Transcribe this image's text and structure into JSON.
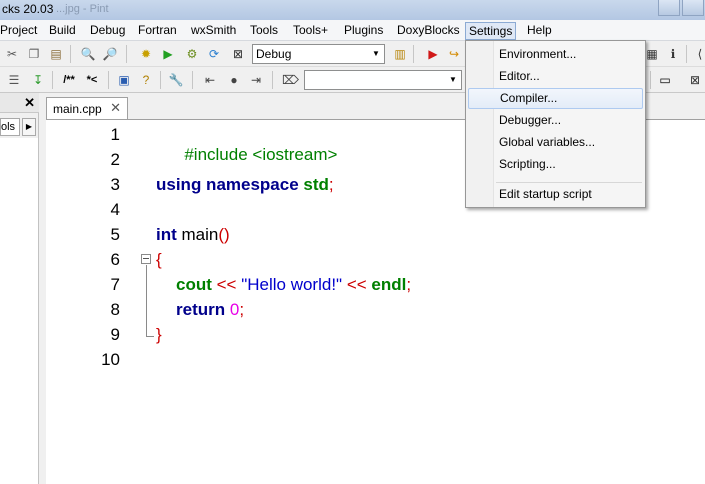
{
  "window": {
    "title": "cks 20.03",
    "title_ghost": "...jpg - Pint"
  },
  "menubar": {
    "items": [
      "Project",
      "Build",
      "Debug",
      "Fortran",
      "wxSmith",
      "Tools",
      "Tools+",
      "Plugins",
      "DoxyBlocks",
      "Settings",
      "Help"
    ],
    "active": "Settings"
  },
  "toolbar": {
    "build_target": "Debug"
  },
  "left_panel": {
    "tab_label": "ols"
  },
  "editor": {
    "tab_label": "main.cpp",
    "line_numbers": [
      "1",
      "2",
      "3",
      "4",
      "5",
      "6",
      "7",
      "8",
      "9",
      "10"
    ],
    "code": {
      "l1": "#include <iostream>",
      "l3_kw1": "using namespace",
      "l3_id": "std",
      "l3_end": ";",
      "l5_kw": "int",
      "l5_name": " main",
      "l5_paren": "()",
      "l6": "{",
      "l7_cout": "cout",
      "l7_op1": " << ",
      "l7_str": "\"Hello world!\"",
      "l7_op2": " << ",
      "l7_endl": "endl",
      "l7_end": ";",
      "l8_kw": "return",
      "l8_num": "0",
      "l8_end": ";",
      "l9": "}"
    }
  },
  "settings_menu": {
    "items": [
      "Environment...",
      "Editor...",
      "Compiler...",
      "Debugger...",
      "Global variables...",
      "Scripting...",
      "Edit startup script"
    ],
    "highlighted": "Compiler..."
  },
  "colors": {
    "keyword": "#00008b",
    "preprocessor": "#008000",
    "operator": "#cc0000",
    "string": "#0000cc",
    "number": "#e800e8",
    "menu_highlight": "#e3ecf8"
  }
}
